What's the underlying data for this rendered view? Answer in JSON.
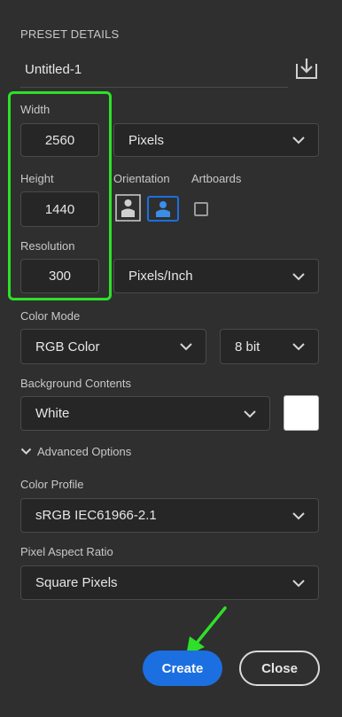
{
  "preset": {
    "section_title": "PRESET DETAILS",
    "name": "Untitled-1",
    "save_icon": "save-preset-icon"
  },
  "width": {
    "label": "Width",
    "value": "2560",
    "unit": "Pixels"
  },
  "height": {
    "label": "Height",
    "value": "1440"
  },
  "orientation": {
    "label": "Orientation",
    "selected": "landscape"
  },
  "artboards": {
    "label": "Artboards",
    "checked": false
  },
  "resolution": {
    "label": "Resolution",
    "value": "300",
    "unit": "Pixels/Inch"
  },
  "color_mode": {
    "label": "Color Mode",
    "mode": "RGB Color",
    "depth": "8 bit"
  },
  "background": {
    "label": "Background Contents",
    "value": "White",
    "swatch": "#ffffff"
  },
  "advanced": {
    "label": "Advanced Options"
  },
  "color_profile": {
    "label": "Color Profile",
    "value": "sRGB IEC61966-2.1"
  },
  "pixel_aspect": {
    "label": "Pixel Aspect Ratio",
    "value": "Square Pixels"
  },
  "buttons": {
    "create": "Create",
    "close": "Close"
  },
  "colors": {
    "highlight": "#2ee02a",
    "accent": "#1c6fe0",
    "panel": "#2f2f2f",
    "field": "#262626"
  }
}
